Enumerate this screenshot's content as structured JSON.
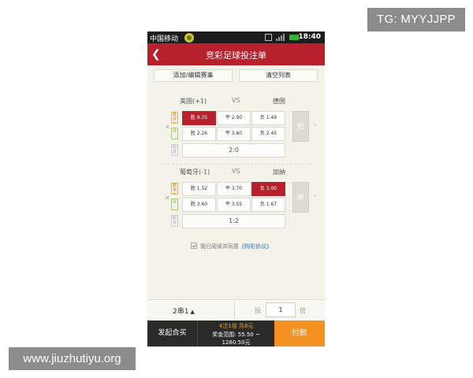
{
  "watermarks": {
    "tg": "TG: MYYJJPP",
    "site": "www.jiuzhutiyu.org"
  },
  "status_bar": {
    "carrier": "中国移动",
    "time": "18:40"
  },
  "header": {
    "title": "竞彩足球投注单"
  },
  "toolbar": {
    "add_label": "添加/编辑赛事",
    "clear_label": "清空列表"
  },
  "matches": [
    {
      "home": "美国(+1)",
      "vs": "VS",
      "away": "德国",
      "rows": [
        {
          "icon": "胜平负",
          "cells": [
            "胜 9.25",
            "平 2.90",
            "负 1.49"
          ],
          "selected": 0
        },
        {
          "icon": "让",
          "cells": [
            "胜 2.26",
            "平 3.60",
            "负 2.45"
          ],
          "selected": -1
        },
        {
          "icon": "比分",
          "score": "2:0"
        }
      ],
      "banker": "胆"
    },
    {
      "home": "葡萄牙(-1)",
      "vs": "VS",
      "away": "加纳",
      "rows": [
        {
          "icon": "胜平负",
          "cells": [
            "胜 1.52",
            "平 3.70",
            "负 3.00"
          ],
          "selected": 2
        },
        {
          "icon": "让",
          "cells": [
            "胜 3.60",
            "平 3.55",
            "负 1.67"
          ],
          "selected": -1
        },
        {
          "icon": "比分",
          "score": "1:2"
        }
      ],
      "banker": "胆"
    }
  ],
  "agreement": {
    "text": "我已阅读并同意",
    "link": "《购彩协议》"
  },
  "bet_bar": {
    "pass_type": "2串1",
    "mult_prefix": "投",
    "multiplier": "1",
    "mult_suffix": "倍"
  },
  "footer": {
    "group_buy": "发起合买",
    "summary_line1": "4注1倍 共8元",
    "summary_line2": "奖金范围: 55.50 ~",
    "summary_line3": "1280.50元",
    "pay_label": "付款"
  },
  "colors": {
    "brand_red": "#b8202c",
    "pay_orange": "#f39222",
    "summary_orange": "#f0a11c"
  }
}
